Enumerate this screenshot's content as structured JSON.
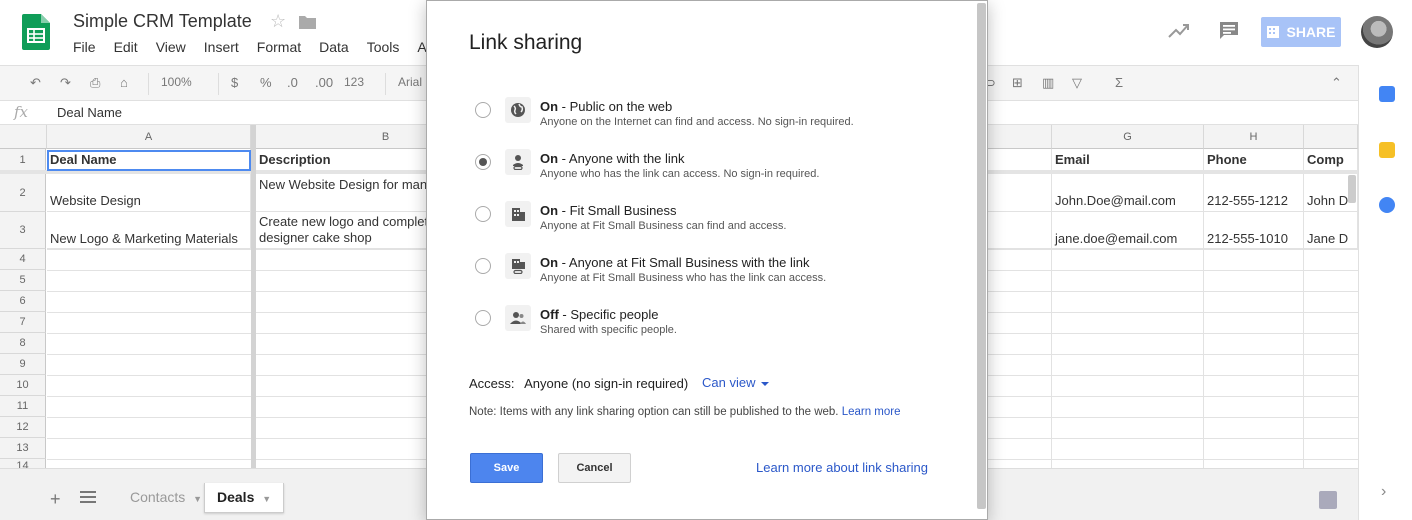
{
  "app": {
    "title": "Simple CRM Template",
    "menu": [
      "File",
      "Edit",
      "View",
      "Insert",
      "Format",
      "Data",
      "Tools",
      "Add"
    ],
    "share_label": "SHARE",
    "brand_color": "#0f9d58",
    "accent_color": "#4d85ee"
  },
  "toolbar": {
    "zoom": "100%",
    "currency": "$",
    "percent": "%",
    "dec_less": ".0",
    "dec_more": ".00",
    "format_more": "123",
    "font": "Arial"
  },
  "formula": {
    "fx": "fx",
    "value": "Deal Name"
  },
  "sheet": {
    "columns": [
      "A",
      "B",
      "G",
      "H"
    ],
    "row_numbers": [
      "1",
      "2",
      "3",
      "4",
      "5",
      "6",
      "7",
      "8",
      "9",
      "10",
      "11",
      "12",
      "13",
      "14"
    ],
    "headers": {
      "a": "Deal Name",
      "b": "Description",
      "g": "Email",
      "h": "Phone",
      "i": "Comp"
    },
    "rows": [
      {
        "a": "Website Design",
        "b": "New Website Design for man company",
        "g": "John.Doe@mail.com",
        "h": "212-555-1212",
        "i": "John D"
      },
      {
        "a": "New Logo & Marketing Materials",
        "b": "Create new logo and complet high-end designer cake shop",
        "g": "jane.doe@email.com",
        "h": "212-555-1010",
        "i": "Jane D"
      }
    ]
  },
  "tabs": [
    {
      "label": "Contacts",
      "active": false
    },
    {
      "label": "Deals",
      "active": true
    }
  ],
  "dialog": {
    "title": "Link sharing",
    "options": [
      {
        "state": "On",
        "label": " - Public on the web",
        "desc": "Anyone on the Internet can find and access. No sign-in required.",
        "selected": false,
        "icon": "globe-icon"
      },
      {
        "state": "On",
        "label": " - Anyone with the link",
        "desc": "Anyone who has the link can access. No sign-in required.",
        "selected": true,
        "icon": "person-link-icon"
      },
      {
        "state": "On",
        "label": " - Fit Small Business",
        "desc": "Anyone at Fit Small Business can find and access.",
        "selected": false,
        "icon": "building-icon"
      },
      {
        "state": "On",
        "label": " - Anyone at Fit Small Business with the link",
        "desc": "Anyone at Fit Small Business who has the link can access.",
        "selected": false,
        "icon": "building-link-icon"
      },
      {
        "state": "Off",
        "label": " - Specific people",
        "desc": "Shared with specific people.",
        "selected": false,
        "icon": "people-icon"
      }
    ],
    "access_label": "Access:",
    "access_value": "Anyone (no sign-in required)",
    "can_view": "Can view",
    "note": "Note: Items with any link sharing option can still be published to the web.",
    "note_link": "Learn more",
    "save": "Save",
    "cancel": "Cancel",
    "learn_more": "Learn more about link sharing"
  }
}
